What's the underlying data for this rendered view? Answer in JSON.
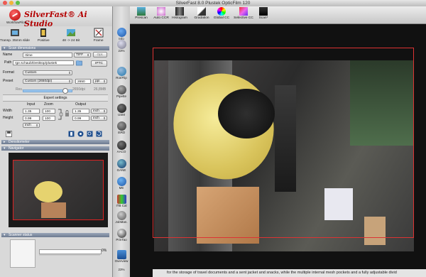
{
  "window": {
    "title": "SilverFast 8.0 Plustek OpticFilm 120"
  },
  "app": {
    "brand": "SilverFast® Ai Studio",
    "workflow_label": "WorkflowPilot"
  },
  "modes": [
    {
      "label": "Transp. 35mm slide",
      "icon": "film-slide-icon"
    },
    {
      "label": "Positive",
      "icon": "positive-film-icon"
    },
    {
      "label": "48 -> 24 Bit",
      "icon": "bit-depth-icon"
    },
    {
      "label": "Frame",
      "icon": "frame-icon"
    }
  ],
  "scan_dimensions": {
    "section_label": "Scan dimensions",
    "name_label": "Name",
    "name_value": "rtime",
    "filetype": "TIFF",
    "opt_label": "Opt.",
    "path_label": "Path",
    "path_value": "rge.schaub/Desktop/plustek",
    "iptc_label": "IPTC",
    "format_label": "Format",
    "format_value": "Custom",
    "preset_label": "Preset",
    "preset_value": "Custom (2650dpi)",
    "preset_number": "2650",
    "preset_unit": "ppi",
    "res_label": "Res.",
    "res_value": "2650dpi",
    "file_size": "26,8MB",
    "expert_label": "Expert settings",
    "col_input": "Input",
    "col_zoom": "Zoom",
    "col_output": "Output",
    "width_label": "Width",
    "height_label": "Height",
    "width_input": "1.35",
    "width_zoom": "100",
    "width_output": "1.35",
    "height_input": "0.99",
    "height_zoom": "100",
    "height_output": "0.99",
    "unit_input": "inch",
    "unit_output": "inch"
  },
  "densitometer": {
    "section_label": "Densitometer"
  },
  "navigator": {
    "section_label": "Navigator"
  },
  "scanner_status": {
    "section_label": "Scanner status",
    "progress_percent": "0%"
  },
  "sidebar_tools": [
    {
      "label": "Info",
      "icon": "info-icon"
    },
    {
      "label": "23%",
      "icon": "zoom-icon"
    },
    {
      "label": "Rot/Flip",
      "icon": "rotate-flip-icon"
    },
    {
      "label": "Pipette",
      "icon": "pipette-icon"
    },
    {
      "label": "USM",
      "icon": "usm-icon"
    },
    {
      "label": "iSRD",
      "icon": "isrd-icon"
    },
    {
      "label": "AACO",
      "icon": "aaco-icon"
    },
    {
      "label": "GANE",
      "icon": "gane-icon"
    },
    {
      "label": "ME",
      "icon": "me-icon"
    },
    {
      "label": "ITB Cal",
      "icon": "itb-cal-icon"
    },
    {
      "label": "JobMan.",
      "icon": "jobmanager-icon"
    },
    {
      "label": "PrinTao",
      "icon": "printao-icon"
    },
    {
      "label": "Overview",
      "icon": "overview-icon"
    },
    {
      "label": "23%",
      "icon": "zoom-level-icon"
    }
  ],
  "toolbar": [
    {
      "label": "Prescan",
      "icon": "prescan-icon"
    },
    {
      "label": "Auto CCR",
      "icon": "auto-ccr-icon"
    },
    {
      "label": "Histogram",
      "icon": "histogram-icon"
    },
    {
      "label": "Gradation",
      "icon": "gradation-icon"
    },
    {
      "label": "Global CC",
      "icon": "global-cc-icon"
    },
    {
      "label": "Selective CC",
      "icon": "selective-cc-icon"
    },
    {
      "label": "Scan*",
      "icon": "scan-icon"
    }
  ],
  "caption": "for the storage of travel documents and a sent jacket and snacks, while the multiple internal mesh pockets and a fully adjustable divid",
  "colors": {
    "brand_red": "#b30000",
    "frame_red": "#dd3333",
    "section_blue": "#7d8aa0"
  }
}
